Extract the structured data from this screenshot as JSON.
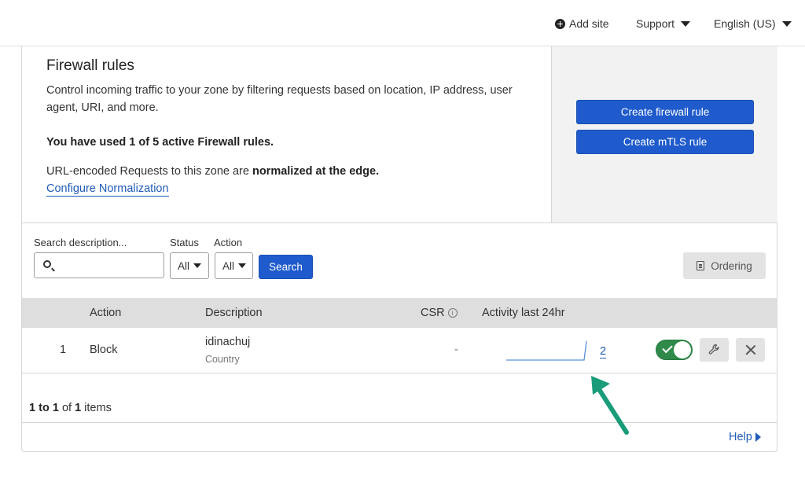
{
  "topbar": {
    "add_site": "Add site",
    "support": "Support",
    "language": "English (US)"
  },
  "intro": {
    "title": "Firewall rules",
    "description": "Control incoming traffic to your zone by filtering requests based on location, IP address, user agent, URI, and more.",
    "usage": "You have used 1 of 5 active Firewall rules.",
    "normalization_prefix": "URL-encoded Requests to this zone are ",
    "normalization_bold": "normalized at the edge.",
    "configure_link": "Configure Normalization"
  },
  "actions": {
    "create_firewall_rule": "Create firewall rule",
    "create_mtls_rule": "Create mTLS rule"
  },
  "filters": {
    "search_label": "Search description...",
    "search_value": "",
    "status_label": "Status",
    "status_value": "All",
    "action_label": "Action",
    "action_value": "All",
    "search_button": "Search",
    "ordering_button": "Ordering"
  },
  "table": {
    "headers": {
      "action": "Action",
      "description": "Description",
      "csr": "CSR",
      "csr_info": "i",
      "activity": "Activity last 24hr"
    },
    "rows": [
      {
        "index": "1",
        "action": "Block",
        "description": "idinachuj",
        "description_sub": "Country",
        "csr": "-",
        "activity_count": "2",
        "enabled": true
      }
    ]
  },
  "pagination": {
    "from": "1",
    "to_word": "to",
    "to": "1",
    "of_word": "of",
    "total": "1",
    "items_word": "items"
  },
  "footer": {
    "help": "Help"
  },
  "colors": {
    "primary": "#1f5bcc",
    "toggle_on": "#2f8a4a",
    "annotation_arrow": "#1a9c7a"
  }
}
